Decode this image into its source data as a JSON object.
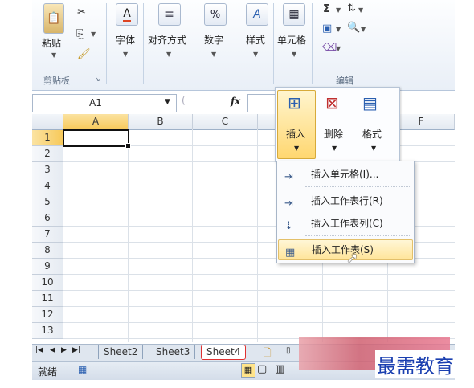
{
  "ribbon": {
    "clipboard": {
      "paste_label": "粘贴",
      "group_label": "剪贴板"
    },
    "font_label": "字体",
    "align_label": "对齐方式",
    "number_label": "数字",
    "styles_label": "样式",
    "cells_label": "单元格",
    "edit_group_label": "编辑",
    "sigma": "Σ",
    "icons": {
      "sort": "sort-filter-icon",
      "find": "find-icon",
      "clear": "clear-icon"
    }
  },
  "formula_bar": {
    "name_box": "A1",
    "fx": "fx"
  },
  "columns": [
    "A",
    "B",
    "C",
    "F"
  ],
  "rows": [
    "1",
    "2",
    "3",
    "4",
    "5",
    "6",
    "7",
    "8",
    "9",
    "10",
    "11",
    "12",
    "13"
  ],
  "insert_panel": {
    "insert_label": "插入",
    "delete_label": "删除",
    "format_label": "格式"
  },
  "menu": {
    "items": [
      {
        "label": "插入单元格(I)..."
      },
      {
        "label": "插入工作表行(R)"
      },
      {
        "label": "插入工作表列(C)"
      },
      {
        "label": "插入工作表(S)"
      }
    ]
  },
  "sheets": [
    "Sheet2",
    "Sheet3",
    "Sheet4"
  ],
  "status": {
    "ready": "就绪"
  },
  "watermark": "最需教育",
  "colors": {
    "selected_tab_border": "#e03030",
    "active_cell": "#ffd36b",
    "watermark": "#1a3fb0"
  }
}
